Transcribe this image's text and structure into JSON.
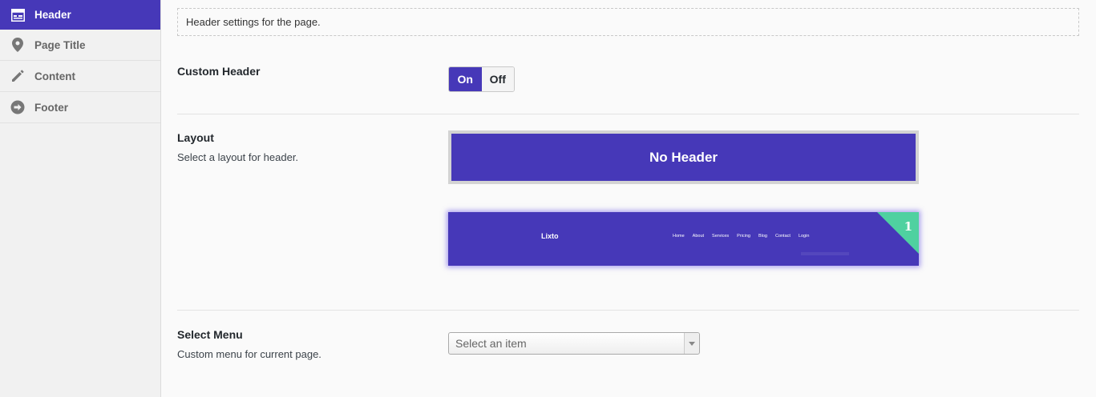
{
  "sidebar": {
    "items": [
      {
        "label": "Header",
        "icon": "layout-icon",
        "active": true
      },
      {
        "label": "Page Title",
        "icon": "location-pin-icon",
        "active": false
      },
      {
        "label": "Content",
        "icon": "pencil-icon",
        "active": false
      },
      {
        "label": "Footer",
        "icon": "arrow-circle-right-icon",
        "active": false
      }
    ]
  },
  "main": {
    "description": "Header settings for the page.",
    "custom_header": {
      "title": "Custom Header",
      "on_label": "On",
      "off_label": "Off",
      "value": "On"
    },
    "layout": {
      "title": "Layout",
      "subtitle": "Select a layout for header.",
      "no_header_label": "No Header",
      "preview": {
        "logo": "Lixto",
        "nav": [
          "Home",
          "About",
          "Services",
          "Pricing",
          "Blog",
          "Contact",
          "Login"
        ],
        "badge": "1"
      }
    },
    "select_menu": {
      "title": "Select Menu",
      "subtitle": "Custom menu for current page.",
      "placeholder": "Select an item"
    }
  },
  "colors": {
    "accent": "#4638b8",
    "badge": "#4fd1a0"
  }
}
